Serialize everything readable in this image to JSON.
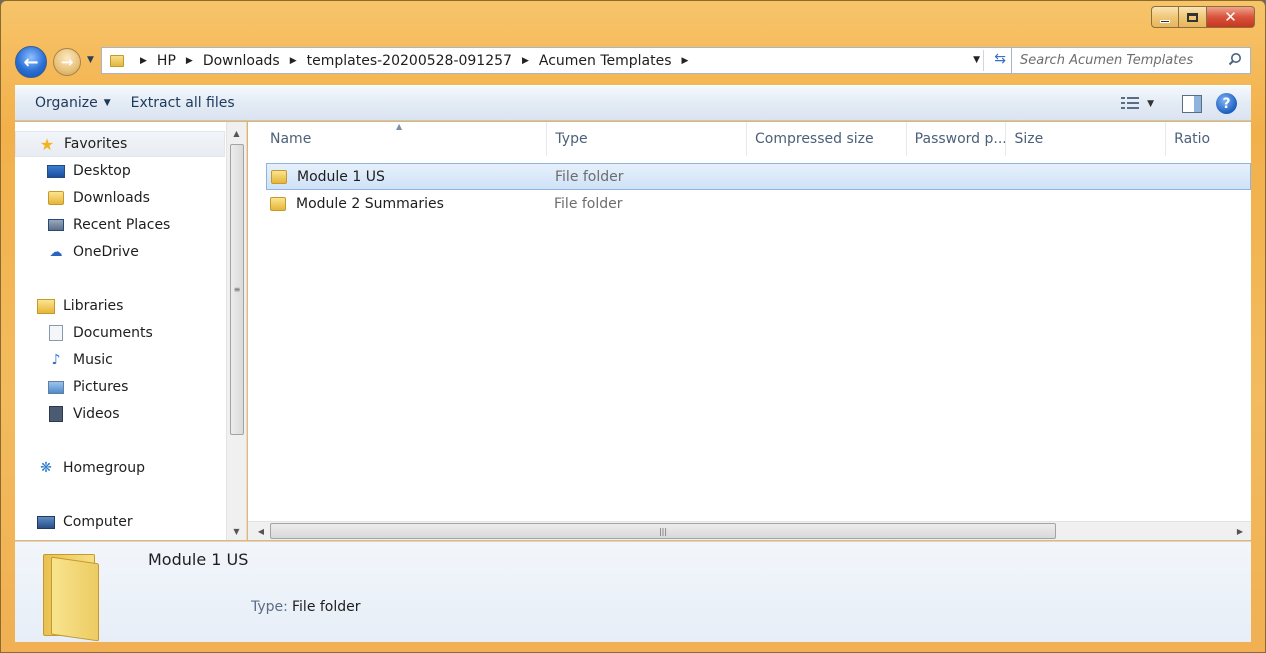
{
  "window": {
    "controls": {
      "minimize": "",
      "maximize": "",
      "close": "✕"
    }
  },
  "nav": {
    "back_glyph": "←",
    "forward_glyph": "→",
    "breadcrumbs": [
      "HP",
      "Downloads",
      "templates-20200528-091257",
      "Acumen Templates"
    ],
    "search_placeholder": "Search Acumen Templates"
  },
  "toolbar": {
    "organize_label": "Organize",
    "extract_label": "Extract all files"
  },
  "sidebar": {
    "favorites": {
      "label": "Favorites",
      "items": [
        "Desktop",
        "Downloads",
        "Recent Places",
        "OneDrive"
      ]
    },
    "libraries": {
      "label": "Libraries",
      "items": [
        "Documents",
        "Music",
        "Pictures",
        "Videos"
      ]
    },
    "homegroup": {
      "label": "Homegroup"
    },
    "computer": {
      "label": "Computer"
    }
  },
  "columns": [
    "Name",
    "Type",
    "Compressed size",
    "Password p...",
    "Size",
    "Ratio"
  ],
  "files": [
    {
      "name": "Module 1 US",
      "type": "File folder",
      "selected": true
    },
    {
      "name": "Module 2 Summaries",
      "type": "File folder",
      "selected": false
    }
  ],
  "details": {
    "name": "Module 1 US",
    "type_label": "Type:",
    "type_value": "File folder"
  },
  "colors": {
    "title_bar": "#f2b04a",
    "accent_blue": "#2a6fd6",
    "selection": "#cfe2f7"
  }
}
